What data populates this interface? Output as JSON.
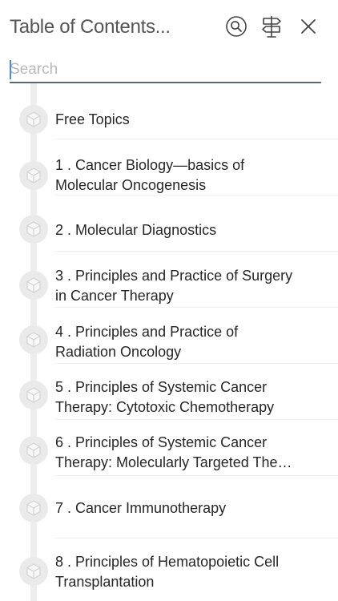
{
  "header": {
    "title": "Table of Contents...",
    "search_icon": "search-circle-icon",
    "signpost_icon": "signpost-icon",
    "close_icon": "close-icon"
  },
  "search": {
    "placeholder": "Search",
    "value": ""
  },
  "colors": {
    "accent": "#566a7a",
    "caret": "#4a90d9",
    "timeline": "#eeeeee"
  },
  "toc": {
    "item_icon": "cube-icon",
    "items": [
      {
        "lines": [
          "Free Topics"
        ]
      },
      {
        "lines": [
          "1 . Cancer Biology—basics of",
          "Molecular Oncogenesis"
        ]
      },
      {
        "lines": [
          "2 . Molecular Diagnostics"
        ]
      },
      {
        "lines": [
          "3 . Principles and Practice of Surgery",
          "in Cancer Therapy"
        ]
      },
      {
        "lines": [
          "4 . Principles and Practice of",
          "Radiation Oncology"
        ]
      },
      {
        "lines": [
          "5 . Principles of Systemic Cancer",
          "Therapy: Cytotoxic Chemotherapy"
        ]
      },
      {
        "lines": [
          "6 . Principles of Systemic Cancer",
          "Therapy: Molecularly Targeted The…"
        ]
      },
      {
        "lines": [
          "7 . Cancer Immunotherapy"
        ]
      },
      {
        "lines": [
          "8 . Principles of Hematopoietic Cell",
          "Transplantation"
        ]
      }
    ]
  }
}
